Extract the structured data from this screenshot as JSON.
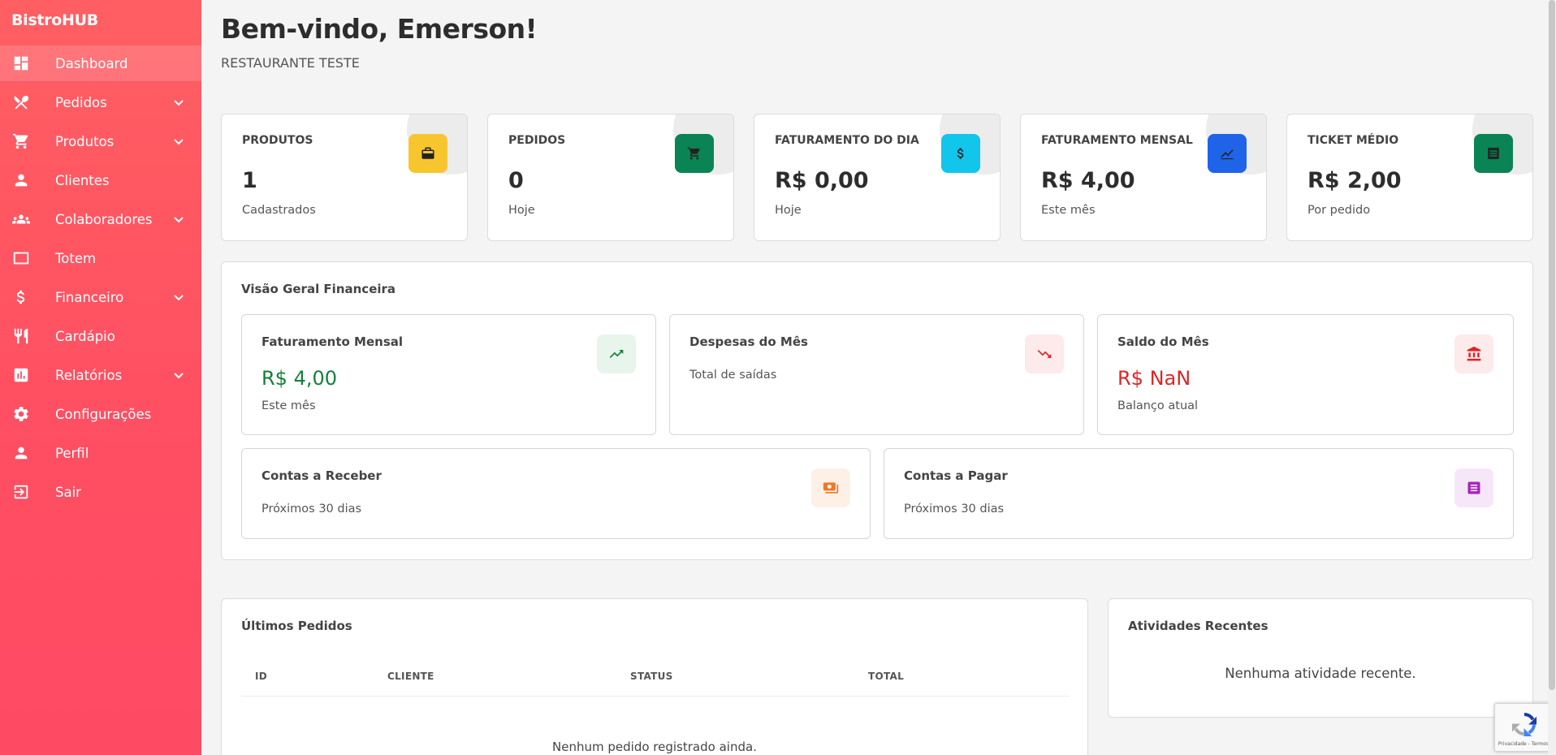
{
  "sidebar": {
    "brand": "BistroHUB",
    "items": [
      {
        "label": "Dashboard",
        "icon": "dashboard-icon",
        "active": true,
        "chevron": false
      },
      {
        "label": "Pedidos",
        "icon": "utensils-icon",
        "active": false,
        "chevron": true
      },
      {
        "label": "Produtos",
        "icon": "cart-icon",
        "active": false,
        "chevron": true
      },
      {
        "label": "Clientes",
        "icon": "person-icon",
        "active": false,
        "chevron": false
      },
      {
        "label": "Colaboradores",
        "icon": "group-icon",
        "active": false,
        "chevron": true
      },
      {
        "label": "Totem",
        "icon": "monitor-icon",
        "active": false,
        "chevron": false
      },
      {
        "label": "Financeiro",
        "icon": "dollar-icon",
        "active": false,
        "chevron": true
      },
      {
        "label": "Cardápio",
        "icon": "fork-knife-icon",
        "active": false,
        "chevron": false
      },
      {
        "label": "Relatórios",
        "icon": "bar-chart-icon",
        "active": false,
        "chevron": true
      },
      {
        "label": "Configurações",
        "icon": "gear-icon",
        "active": false,
        "chevron": false
      },
      {
        "label": "Perfil",
        "icon": "person-icon",
        "active": false,
        "chevron": false
      },
      {
        "label": "Sair",
        "icon": "logout-icon",
        "active": false,
        "chevron": false
      }
    ]
  },
  "header": {
    "welcome": "Bem-vindo, Emerson!",
    "restaurant": "RESTAURANTE TESTE"
  },
  "stats": [
    {
      "title": "PRODUTOS",
      "value": "1",
      "sub": "Cadastrados",
      "icon": "box-icon",
      "color": "#f7c52e"
    },
    {
      "title": "PEDIDOS",
      "value": "0",
      "sub": "Hoje",
      "icon": "cart-icon",
      "color": "#0b8455"
    },
    {
      "title": "FATURAMENTO DO DIA",
      "value": "R$ 0,00",
      "sub": "Hoje",
      "icon": "dollar-icon",
      "color": "#12c5eb"
    },
    {
      "title": "FATURAMENTO MENSAL",
      "value": "R$ 4,00",
      "sub": "Este mês",
      "icon": "chart-line-icon",
      "color": "#1f63e8"
    },
    {
      "title": "TICKET MÉDIO",
      "value": "R$ 2,00",
      "sub": "Por pedido",
      "icon": "receipt-icon",
      "color": "#0b8455"
    }
  ],
  "financial": {
    "title": "Visão Geral Financeira",
    "monthly_revenue": {
      "title": "Faturamento Mensal",
      "value": "R$ 4,00",
      "sub": "Este mês",
      "icon": "trending-up-icon",
      "color": "#15803d"
    },
    "monthly_expenses": {
      "title": "Despesas do Mês",
      "sub": "Total de saídas",
      "icon": "trending-down-icon",
      "color": "#dc2626"
    },
    "monthly_balance": {
      "title": "Saldo do Mês",
      "value": "R$ NaN",
      "sub": "Balanço atual",
      "icon": "bank-icon",
      "color": "#dc2626"
    },
    "receivables": {
      "title": "Contas a Receber",
      "sub": "Próximos 30 dias",
      "icon": "money-icon",
      "color": "#ea7a2a"
    },
    "payables": {
      "title": "Contas a Pagar",
      "sub": "Próximos 30 dias",
      "icon": "document-icon",
      "color": "#a626b8"
    }
  },
  "orders": {
    "title": "Últimos Pedidos",
    "columns": [
      "ID",
      "CLIENTE",
      "STATUS",
      "TOTAL"
    ],
    "empty": "Nenhum pedido registrado ainda."
  },
  "activities": {
    "title": "Atividades Recentes",
    "empty": "Nenhuma atividade recente."
  },
  "recaptcha": {
    "text": "Privacidade - Termos"
  }
}
